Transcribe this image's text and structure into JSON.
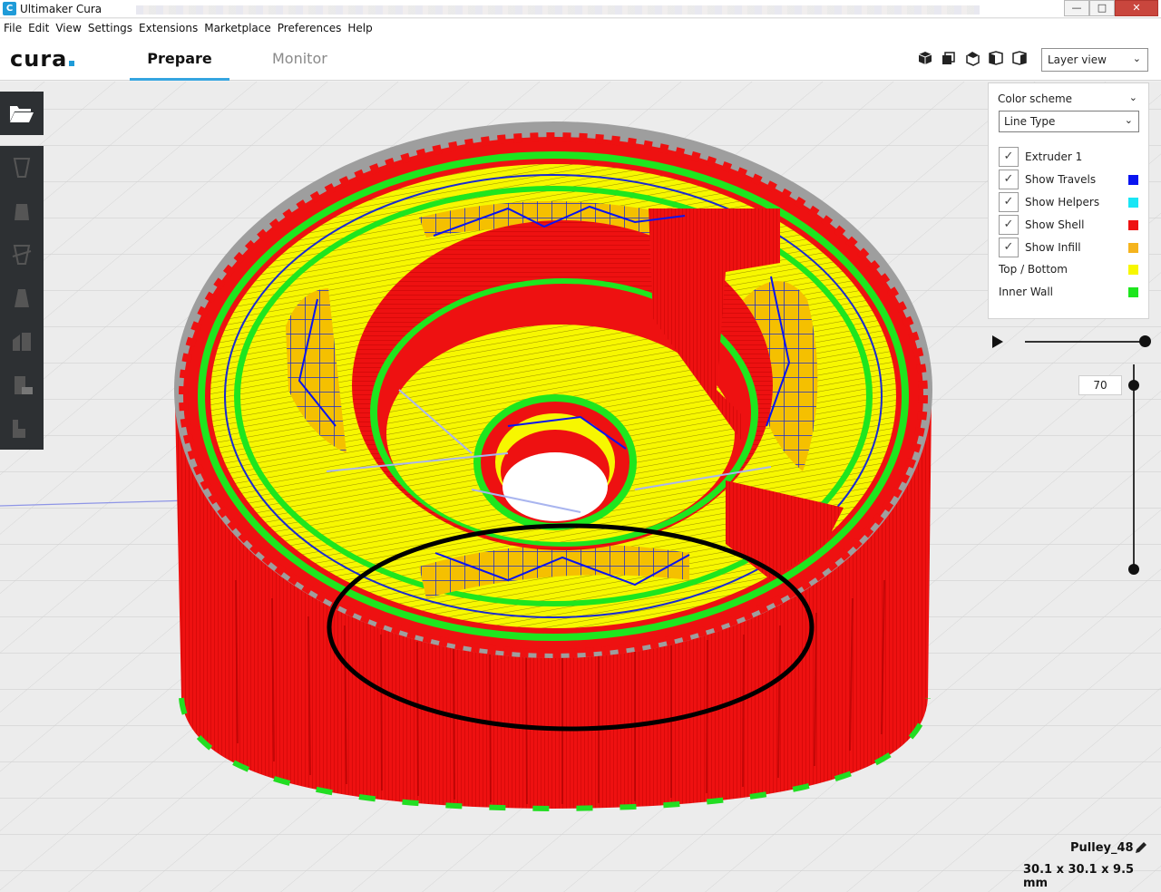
{
  "window": {
    "title": "Ultimaker Cura",
    "app_icon": "C"
  },
  "menu": [
    "File",
    "Edit",
    "View",
    "Settings",
    "Extensions",
    "Marketplace",
    "Preferences",
    "Help"
  ],
  "header": {
    "logo": "cura",
    "tabs": {
      "prepare": "Prepare",
      "monitor": "Monitor"
    },
    "view_mode": "Layer view",
    "view_icons": [
      "3d-view-icon",
      "front-view-icon",
      "top-view-icon",
      "left-view-icon",
      "right-view-icon"
    ]
  },
  "toolbar": {
    "open_icon": "folder-open-icon",
    "tools": [
      "move-tool-icon",
      "scale-tool-icon",
      "rotate-tool-icon",
      "mirror-tool-icon",
      "per-model-settings-icon",
      "support-blocker-icon",
      "layer-tool-icon"
    ]
  },
  "layer_panel": {
    "color_scheme_label": "Color scheme",
    "scheme": "Line Type",
    "items": [
      {
        "label": "Extruder 1",
        "checked": true,
        "color": ""
      },
      {
        "label": "Show Travels",
        "checked": true,
        "color": "#0a14f0"
      },
      {
        "label": "Show Helpers",
        "checked": true,
        "color": "#19e6f5"
      },
      {
        "label": "Show Shell",
        "checked": true,
        "color": "#ee1111"
      },
      {
        "label": "Show Infill",
        "checked": true,
        "color": "#f5b41e"
      },
      {
        "label": "Top / Bottom",
        "checked": null,
        "color": "#f7f700"
      },
      {
        "label": "Inner Wall",
        "checked": null,
        "color": "#1ee61e"
      }
    ]
  },
  "slider": {
    "layer": "70"
  },
  "object": {
    "name": "Pulley_48",
    "dimensions": "30.1 x 30.1 x 9.5 mm"
  },
  "colors": {
    "accent": "#35a5e0",
    "shell": "#ee1111",
    "top_bottom": "#f7f700",
    "inner_wall": "#1ee61e",
    "travels": "#0a14f0",
    "infill": "#f5b41e"
  }
}
